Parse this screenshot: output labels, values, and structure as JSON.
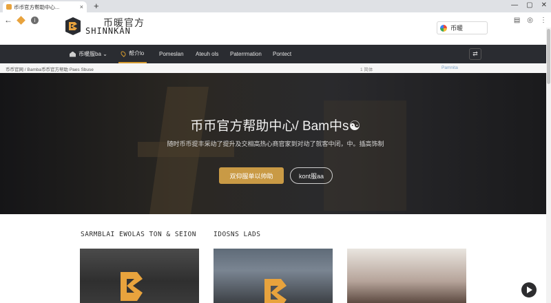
{
  "browser": {
    "tab_title": "币币官方帮助中心...",
    "tab_close": "×",
    "new_tab": "+",
    "controls": [
      "—",
      "▢",
      "✕"
    ],
    "back": "←"
  },
  "site": {
    "logo_cn": "币暖官方",
    "logo_en": "SHINNKAN",
    "search_label": "币暖",
    "brand_color": "#d49a2f"
  },
  "nav": {
    "items": [
      {
        "label": "币暖服ba ⌄"
      },
      {
        "label": "帮介lo"
      },
      {
        "label": "Pomeslan"
      },
      {
        "label": "Ateuh ols"
      },
      {
        "label": "Paterrmation"
      },
      {
        "label": "Pontect"
      }
    ],
    "right_button": "⇄"
  },
  "breadcrumb": {
    "left": "币币官网 / Bamba币币官方帮助 Paes Sbuse",
    "mid": "1  简体",
    "right": "Pamnita"
  },
  "hero": {
    "title": "币币官方帮助中心/ Bam中s☯",
    "subtitle": "随时币币提丰采动了提升及交相高热心商官家到对动了就客中闭，中。插高饰制",
    "primary_button": "双仰服单以帅助",
    "secondary_button": "kont服aa"
  },
  "sections": {
    "left_title": "SARMBLAI EWOLAS TON & SEION",
    "right_title": "IDOSNS LADS"
  },
  "icons": {
    "home": "home-icon",
    "pin": "pin-icon",
    "swap": "swap-icon",
    "play": "play-icon"
  }
}
